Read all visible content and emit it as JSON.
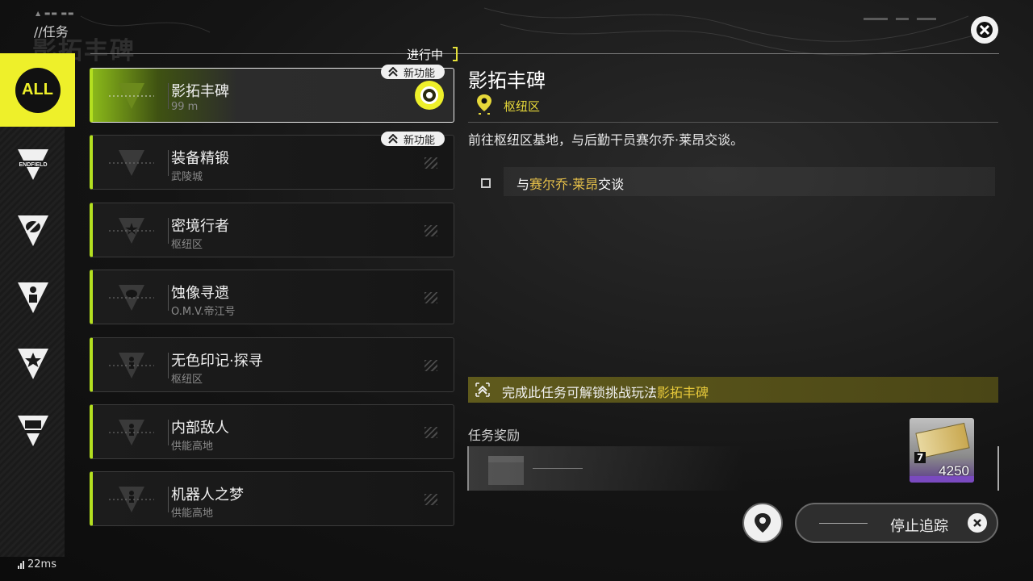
{
  "header": {
    "title": "//任务",
    "status_tag": "进行中"
  },
  "sidebar": {
    "items": [
      {
        "name": "all",
        "label": "ALL"
      },
      {
        "name": "endfield",
        "label": "ENDFIELD"
      },
      {
        "name": "eye"
      },
      {
        "name": "person"
      },
      {
        "name": "star"
      },
      {
        "name": "gate"
      }
    ]
  },
  "quests": [
    {
      "name": "影拓丰碑",
      "sub": "99 m",
      "badge": "新功能",
      "active": true
    },
    {
      "name": "装备精锻",
      "sub": "武陵城",
      "badge": "新功能",
      "active": false
    },
    {
      "name": "密境行者",
      "sub": "枢纽区",
      "active": false
    },
    {
      "name": "蚀像寻遗",
      "sub": "O.M.V.帝江号",
      "active": false
    },
    {
      "name": "无色印记·探寻",
      "sub": "枢纽区",
      "active": false
    },
    {
      "name": "内部敌人",
      "sub": "供能高地",
      "active": false
    },
    {
      "name": "机器人之梦",
      "sub": "供能高地",
      "active": false
    }
  ],
  "detail": {
    "title": "影拓丰碑",
    "location": "枢纽区",
    "description": "前往枢纽区基地，与后勤干员赛尔乔·莱昂交谈。",
    "objective_prefix": "与",
    "objective_highlight": "赛尔乔·莱昂",
    "objective_suffix": "交谈",
    "unlock_prefix": "完成此任务可解锁挑战玩法",
    "unlock_highlight": "影拓丰碑",
    "reward_label": "任务奖励",
    "reward_amount": "4250",
    "reward_level": "7"
  },
  "actions": {
    "stop_tracking": "停止追踪"
  },
  "status": {
    "ping": "22ms"
  },
  "colors": {
    "accent": "#eef02a",
    "quest_bar": "#b4e020",
    "highlight_text": "#e8c24a"
  }
}
